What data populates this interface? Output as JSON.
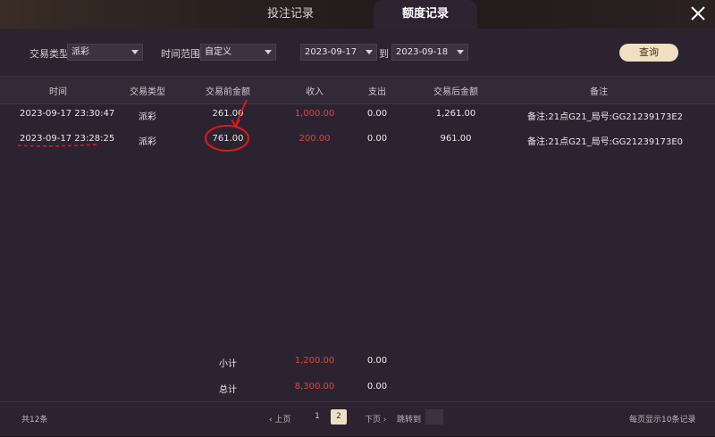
{
  "tabs": {
    "bet_record": "投注记录",
    "quota_record": "额度记录"
  },
  "filters": {
    "type_label": "交易类型",
    "type_value": "派彩",
    "time_label": "时间范围",
    "time_value": "自定义",
    "date_from": "2023-09-17",
    "to_label": "到",
    "date_to": "2023-09-18",
    "query_button": "查询"
  },
  "table": {
    "headers": [
      "时间",
      "交易类型",
      "交易前金额",
      "收入",
      "支出",
      "交易后金额",
      "备注"
    ],
    "rows": [
      {
        "time": "2023-09-17 23:30:47",
        "type": "派彩",
        "before": "261.00",
        "income": "1,000.00",
        "expense": "0.00",
        "after": "1,261.00",
        "note": "备注:21点G21_局号:GG21239173E2"
      },
      {
        "time": "2023-09-17 23:28:25",
        "type": "派彩",
        "before": "761.00",
        "income": "200.00",
        "expense": "0.00",
        "after": "961.00",
        "note": "备注:21点G21_局号:GG21239173E0"
      }
    ],
    "subtotal": {
      "label": "小计",
      "income": "1,200.00",
      "expense": "0.00"
    },
    "total": {
      "label": "总计",
      "income": "8,300.00",
      "expense": "0.00"
    }
  },
  "footer": {
    "count": "共12条",
    "prev": "上页",
    "page1": "1",
    "page2": "2",
    "next": "下页",
    "jump": "跳转到",
    "per_page": "每页显示10条记录"
  },
  "colors": {
    "accent": "#f1dfc2",
    "income_red": "#e0433e",
    "annotation_red": "#e01818"
  }
}
